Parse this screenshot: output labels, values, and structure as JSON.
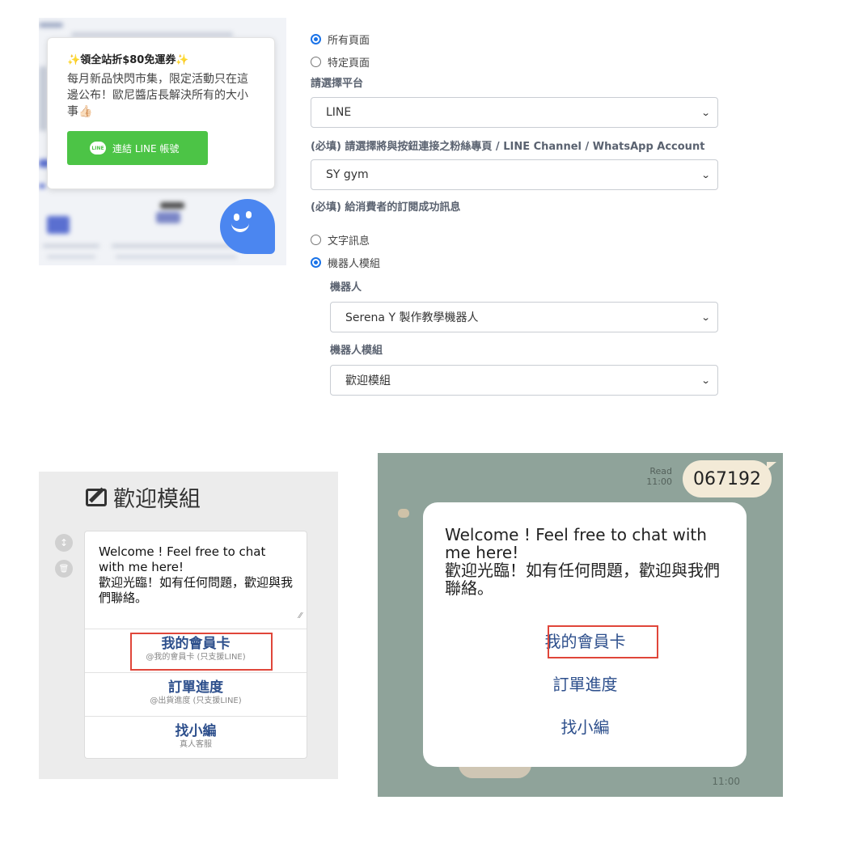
{
  "promo": {
    "title": "領全站折$80免運券",
    "title_spark": "✨",
    "body": "每月新品快閃市集，限定活動只在這邊公布！歐尼醬店長解決所有的大小事👍🏻",
    "line_badge": "LINE",
    "connect_button": "連結 LINE 帳號"
  },
  "form": {
    "page_options": [
      {
        "label": "所有頁面",
        "selected": true
      },
      {
        "label": "特定頁面",
        "selected": false
      }
    ],
    "platform_label": "請選擇平台",
    "platform_value": "LINE",
    "channel_label": "(必填) 請選擇將與按鈕連接之粉絲專頁 / LINE Channel / WhatsApp Account",
    "channel_value": "SY gym",
    "success_label": "(必填) 給消費者的訂閱成功訊息",
    "message_options": [
      {
        "label": "文字訊息",
        "selected": false
      },
      {
        "label": "機器人模組",
        "selected": true
      }
    ],
    "bot_label": "機器人",
    "bot_value": "Serena Y 製作教學機器人",
    "module_label": "機器人模組",
    "module_value": "歡迎模組"
  },
  "editor": {
    "title": "歡迎模組",
    "message": "Welcome ! Feel free to chat with me here!\n歡迎光臨！如有任何問題，歡迎與我們聯絡。",
    "move_icon": "↕",
    "delete_icon": "🗑",
    "buttons": [
      {
        "title": "我的會員卡",
        "sub": "@我的會員卡 (只支援LINE)",
        "highlighted": true
      },
      {
        "title": "訂單進度",
        "sub": "@出貨進度 (只支援LINE)",
        "highlighted": false
      },
      {
        "title": "找小編",
        "sub": "真人客服",
        "highlighted": false
      }
    ]
  },
  "chat": {
    "read_label": "Read",
    "read_time": "11:00",
    "user_message": "067192",
    "bot_message": "Welcome ! Feel free to chat with me here!\n歡迎光臨！如有任何問題，歡迎與我們聯絡。",
    "buttons": [
      "我的會員卡",
      "訂單進度",
      "找小編"
    ],
    "highlighted_index": 0,
    "time": "11:00"
  },
  "colors": {
    "line_green": "#4cc446",
    "radio_blue": "#1a73e8",
    "highlight_red": "#e0463a",
    "chat_bg": "#8fa39a",
    "button_text_blue": "#2d4f8c"
  }
}
